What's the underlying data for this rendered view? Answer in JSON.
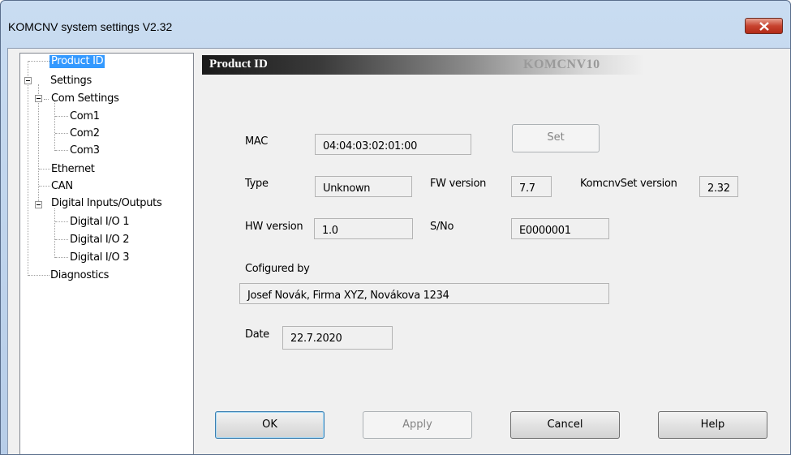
{
  "window": {
    "title": "KOMCNV system settings V2.32"
  },
  "tree": {
    "product_id": "Product ID",
    "settings": "Settings",
    "com_settings": "Com Settings",
    "com1": "Com1",
    "com2": "Com2",
    "com3": "Com3",
    "ethernet": "Ethernet",
    "can": "CAN",
    "dio": "Digital Inputs/Outputs",
    "dio1": "Digital I/O 1",
    "dio2": "Digital I/O 2",
    "dio3": "Digital I/O 3",
    "diagnostics": "Diagnostics"
  },
  "header": {
    "title": "Product ID",
    "model": "KOMCNV10"
  },
  "fields": {
    "mac_label": "MAC",
    "mac_value": "04:04:03:02:01:00",
    "set_label": "Set",
    "type_label": "Type",
    "type_value": "Unknown",
    "fw_label": "FW version",
    "fw_value": "7.7",
    "komcnvset_label": "KomcnvSet version",
    "komcnvset_value": "2.32",
    "hw_label": "HW version",
    "hw_value": "1.0",
    "sno_label": "S/No",
    "sno_value": "E0000001",
    "configured_label": "Cofigured by",
    "configured_value": "Josef Novák, Firma XYZ, Novákova 1234",
    "date_label": "Date",
    "date_value": "22.7.2020"
  },
  "buttons": {
    "ok": "OK",
    "apply": "Apply",
    "cancel": "Cancel",
    "help": "Help"
  }
}
